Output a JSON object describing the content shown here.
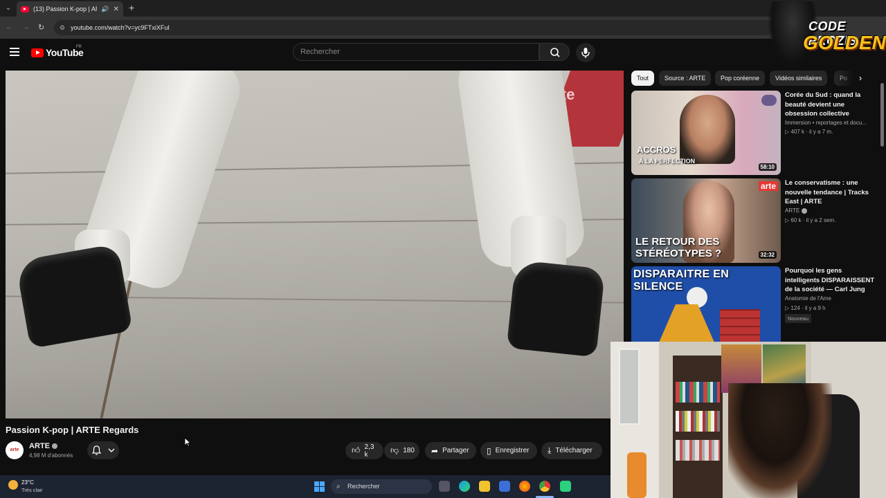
{
  "browser": {
    "tab_title": "(13) Passion K-pop | ARTE R",
    "url": "youtube.com/watch?v=yc9FTxiXFuI"
  },
  "youtube": {
    "logo_text": "YouTube",
    "region": "FR",
    "search_placeholder": "Rechercher"
  },
  "video": {
    "watermark": "arte",
    "title": "Passion K-pop | ARTE Regards",
    "channel": "ARTE",
    "channel_avatar_text": "arte",
    "subscribers": "4,98 M d'abonnés",
    "likes": "2,3 k",
    "dislikes": "180",
    "share_label": "Partager",
    "save_label": "Enregistrer",
    "download_label": "Télécharger"
  },
  "chips": [
    "Tout",
    "Source : ARTE",
    "Pop coréenne",
    "Vidéos similaires",
    "Po"
  ],
  "recommendations": [
    {
      "title": "Corée du Sud : quand la beauté devient une obsession collective",
      "channel": "Immersion • reportages et docu...",
      "meta": "▷ 407 k · il y a 7 m.",
      "duration": "58:10",
      "thumb_text_1": "ACCROS",
      "thumb_text_2": "À LA PERFECTION"
    },
    {
      "title": "Le conservatisme : une nouvelle tendance | Tracks East | ARTE",
      "channel": "ARTE",
      "meta": "▷ 60 k · il y a 2 sem.",
      "duration": "32:32",
      "thumb_text_1": "LE RETOUR DES",
      "thumb_text_2": "STÉRÉOTYPES ?",
      "thumb_badge": "arte"
    },
    {
      "title": "Pourquoi les gens intelligents DISPARAISSENT de la société — Carl Jung",
      "channel": "Anatomie de l'Ame",
      "meta": "▷ 124 · il y a 9 h",
      "badge": "Nouveau",
      "thumb_text_1": "DISPARAITRE EN SILENCE"
    }
  ],
  "overlay": {
    "line1": "CODE PROZIS",
    "line2": "GOLDENG"
  },
  "taskbar": {
    "temperature": "23°C",
    "weather": "Très clair",
    "search": "Rechercher"
  },
  "colors": {
    "background": "#0f0f0f",
    "brand_red": "#ff0000",
    "chip_bg": "#272727",
    "overlay_gold": "#f2c21b"
  }
}
